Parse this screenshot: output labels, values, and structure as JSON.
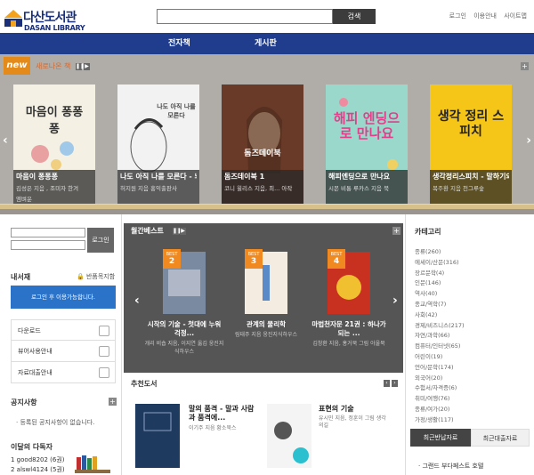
{
  "header": {
    "logo_kr": "다산도서관",
    "logo_en": "DASAN LIBRARY",
    "search_button": "검색",
    "util_links": [
      "로그인",
      "이용안내",
      "사이트맵"
    ]
  },
  "nav": {
    "items": [
      "전자책",
      "게시판"
    ]
  },
  "new_books": {
    "badge": "new",
    "title": "새로나온 책",
    "books": [
      {
        "title": "마음이 퐁퐁퐁",
        "authors": "김성은 지음 , 조미자    한겨",
        "cover_text": "마음이 퐁퐁퐁",
        "extra": "엠벼운"
      },
      {
        "title": "나도 아직 나를 모른다 - 뇌과학과 임상심...",
        "authors": "허지원 지음      홍익출판사",
        "cover_text": "나도 아직 나를 모른다"
      },
      {
        "title": "돔즈데이북 1",
        "authors": "코니 윌리스 지음, 최...    아작",
        "cover_text": "돔즈데이북"
      },
      {
        "title": "해피엔딩으로 만나요",
        "authors": "시몬 비통 루카스 지음    북",
        "cover_text": "해피 엔딩으로 만나요"
      },
      {
        "title": "생각정리스피치 - 말하기와 글쓰기를 동시...",
        "authors": "복주환 지음      천그루숲",
        "cover_text": "생각 정리 스피치"
      }
    ]
  },
  "login": {
    "button": "로그인",
    "my_space": "내서재",
    "my_space_right": "반품목지함",
    "login_notice": "로그인 후 이용가능합니다.",
    "menu": [
      "다운로드",
      "뷰어사용안내",
      "자료대출안내"
    ]
  },
  "notice": {
    "title": "공지사항",
    "empty": "· 등록된 공지사항이 없습니다."
  },
  "monthly": {
    "title": "이달의 다독자",
    "rows": [
      "1  good8202 (6권)",
      "2  alswl4124 (5권)"
    ]
  },
  "best": {
    "title": "월간베스트",
    "books": [
      {
        "badge": "BEST",
        "rank": "2",
        "title": "시작의 기술 - 첫대에 누워 걱정...",
        "author": "개리 비숍 지음, 이지연 옮김    웅진지식하우스"
      },
      {
        "badge": "BEST",
        "rank": "3",
        "title": "관계의 물리학",
        "author": "림태주 지음    웅진지식하우스"
      },
      {
        "badge": "BEST",
        "rank": "4",
        "title": "마법천자문 21권 : 하나가 되는 ...",
        "author": "김창환 지음, 홍거북 그림    아울북"
      }
    ]
  },
  "recommend": {
    "title": "추천도서",
    "books": [
      {
        "title": "말의 품격 - 말과 사람과 품격에...",
        "author": "이기주 지음      황소북스"
      },
      {
        "title": "표현의 기술",
        "author": "유시민 지음, 정훈이 그림    생각의길"
      }
    ]
  },
  "category": {
    "title": "카테고리",
    "items": [
      "종류(260)",
      "에세이/산문(316)",
      "장르문학(4)",
      "인문(146)",
      "역사(40)",
      "종교/역학(7)",
      "사회(42)",
      "경제/비즈니스(217)",
      "자연/과학(66)",
      "컴퓨터/인터넷(65)",
      "어린이(19)",
      "언어/문학(174)",
      "외국어(20)",
      "수험서/자격증(6)",
      "취미/여행(76)",
      "종류/여가(20)",
      "가정/생활(117)"
    ]
  },
  "tabs": {
    "recent_list": "최근반납자료",
    "recent_loan": "최근대출자료",
    "recent_item": "· 그랜드 부다페스트 호텔"
  },
  "colors": {
    "nav": "#1f3d8c",
    "accent": "#e48a1a",
    "best_panel": "#555555",
    "login_box": "#2a73c8"
  }
}
